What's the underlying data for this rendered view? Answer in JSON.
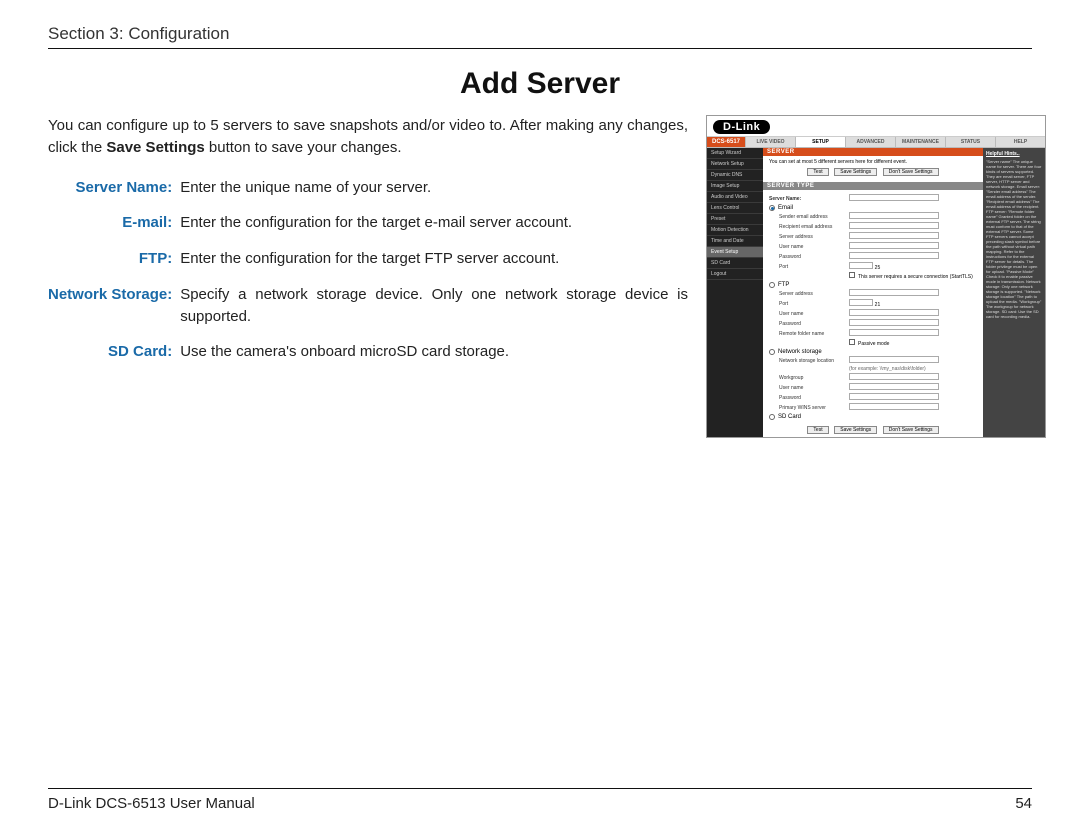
{
  "header": {
    "section": "Section 3: Configuration"
  },
  "title": "Add Server",
  "intro": {
    "pre": "You can configure up to 5 servers to save snapshots and/or video to. After making any changes, click the ",
    "bold": "Save Settings",
    "post": " button to save your changes."
  },
  "defs": [
    {
      "label": "Server Name:",
      "body": "Enter the unique name of your server."
    },
    {
      "label": "E-mail:",
      "body": "Enter the configuration for the target e-mail server account."
    },
    {
      "label": "FTP:",
      "body": "Enter the configuration for the target FTP server account."
    },
    {
      "label": "Network Storage:",
      "body": "Specify a network storage device. Only one network storage device is supported."
    },
    {
      "label": "SD Card:",
      "body": "Use the camera's onboard microSD card storage."
    }
  ],
  "footer": {
    "left": "D-Link DCS-6513 User Manual",
    "right": "54"
  },
  "screenshot": {
    "brand": "D-Link",
    "product": "DCS-6517",
    "tabs": [
      "LIVE VIDEO",
      "SETUP",
      "ADVANCED",
      "MAINTENANCE",
      "STATUS",
      "HELP"
    ],
    "activeTab": "SETUP",
    "sidebar": [
      "Setup Wizard",
      "Network Setup",
      "Dynamic DNS",
      "Image Setup",
      "Audio and Video",
      "Lens Control",
      "Preset",
      "Motion Detection",
      "Time and Date",
      "Event Setup",
      "SD Card",
      "Logout"
    ],
    "sidebarActive": "Event Setup",
    "serverHeader": "SERVER",
    "serverNote": "You can set at most 5 different servers here for different event.",
    "btnTest": "Test",
    "btnSave": "Save Settings",
    "btnDont": "Don't Save Settings",
    "typeHeader": "SERVER TYPE",
    "fieldServerName": "Server Name:",
    "radioEmail": "Email",
    "fSender": "Sender email address",
    "fRecipient": "Recipient email address",
    "fServerAddr": "Server address",
    "fUser": "User name",
    "fPass": "Password",
    "fPort": "Port",
    "portVal": "25",
    "tlsNote": "This server requires a secure connection (StartTLS)",
    "radioFtp": "FTP",
    "ftpPort": "21",
    "fRemote": "Remote folder name",
    "fPassive": "Passive mode",
    "radioNet": "Network storage",
    "fLoc": "Network storage location",
    "locHint": "(for example: \\\\my_nas\\disk\\folder)",
    "fWorkgroup": "Workgroup",
    "fWins": "Primary WINS server",
    "radioSd": "SD Card",
    "hintsHeader": "Helpful Hints..",
    "hints": "\"Server name\" The unique name for server. There are four kinds of servers supported. They are email server, FTP server, HTTP server and network storage.\n\nEmail server:\n\"Sender email address\" The email address of the sender.\n\"Recipient email address\" The email address of the recipient.\n\nFTP server:\n\"Remote folder name\" Granted folder on the external FTP server. The string must conform to that of the external FTP server. Some FTP servers cannot accept preceding slash symbol before the path without virtual path mapping. Refer to the instructions for the external FTP server for details. The folder privilege must be open for upload.\n\"Passive Mode\" Check it to enable passive mode in transmission.\n\nNetwork storage: Only one network storage is supported.\n\"Network storage location\" The path to upload the media.\n\"Workgroup\" The workgroup for network storage.\n\nSD card:\nUse the SD card for recording media."
  }
}
